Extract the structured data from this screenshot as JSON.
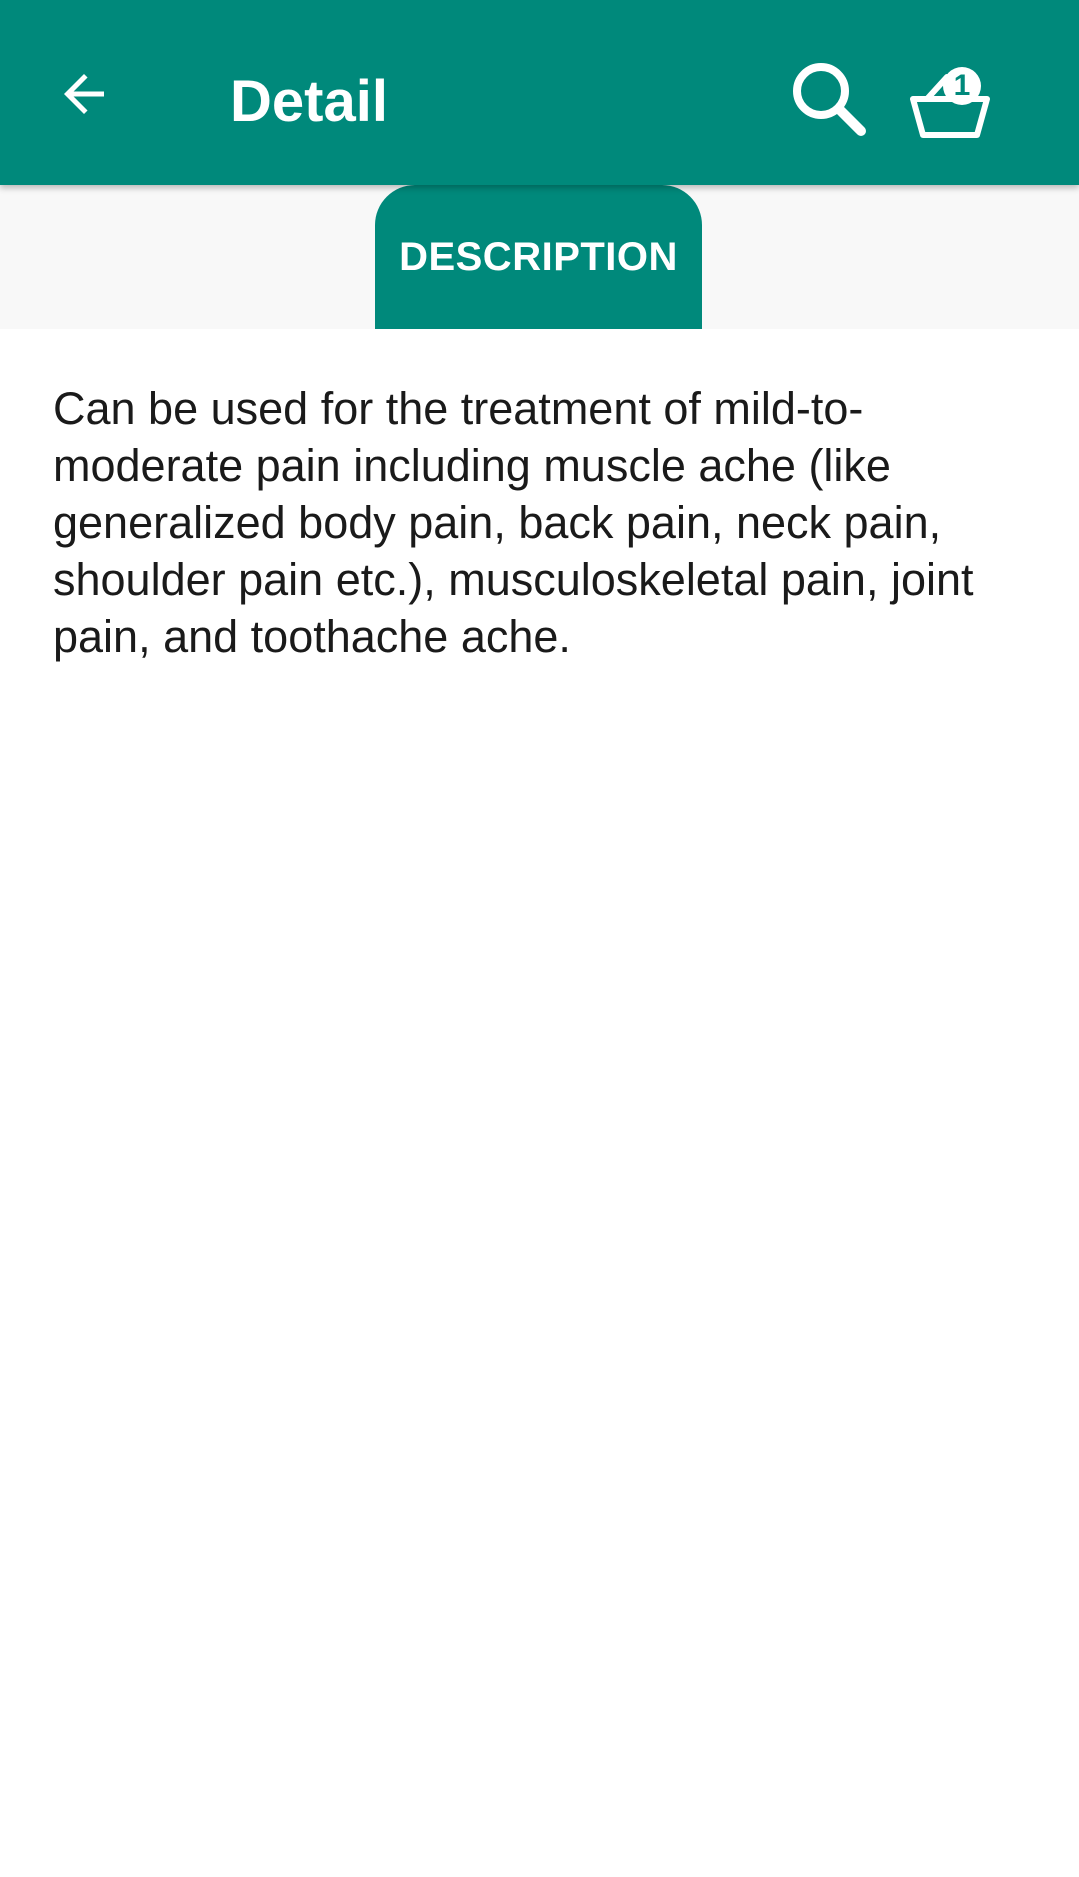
{
  "app_bar": {
    "title": "Detail",
    "back_icon": "arrow-left-icon",
    "search_icon": "search-icon",
    "cart_icon": "basket-icon",
    "cart_count": "1"
  },
  "tabs": [
    {
      "label": "DESCRIPTION",
      "selected": true
    }
  ],
  "content": {
    "description": "Can be used for the treatment of mild-to-moderate pain including muscle ache (like generalized body pain, back pain, neck pain, shoulder pain etc.), musculoskeletal pain, joint pain, and toothache ache."
  },
  "colors": {
    "primary": "#00897b",
    "tab_strip_bg": "#f8f8f8",
    "text": "#1a1a1a"
  }
}
